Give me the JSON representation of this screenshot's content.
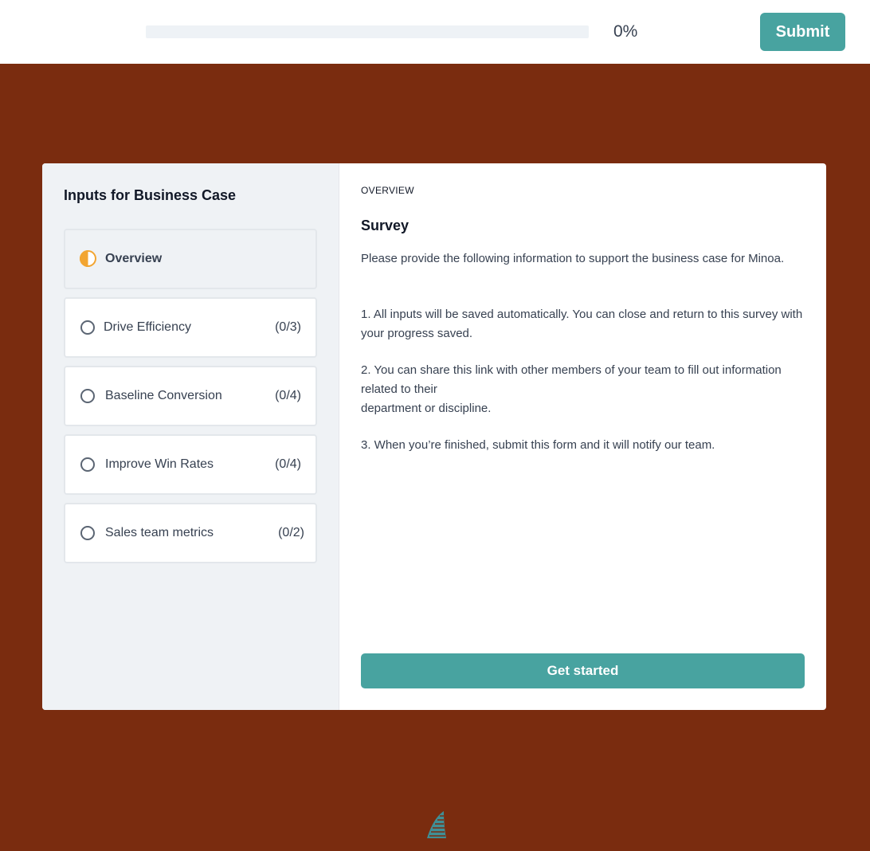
{
  "header": {
    "progress_percent": 0,
    "progress_text": "0%",
    "submit_label": "Submit"
  },
  "sidebar": {
    "title": "Inputs for Business Case",
    "items": [
      {
        "label": "Overview",
        "count": "",
        "status": "in-progress"
      },
      {
        "label": "Drive Efficiency",
        "count": "(0/3)",
        "status": "not-started"
      },
      {
        "label": "Baseline Conversion",
        "count": "(0/4)",
        "status": "not-started"
      },
      {
        "label": "Improve Win Rates",
        "count": "(0/4)",
        "status": "not-started"
      },
      {
        "label": "Sales team metrics",
        "count": "(0/2)",
        "status": "not-started"
      }
    ]
  },
  "main": {
    "section_label": "OVERVIEW",
    "title": "Survey",
    "intro": "Please provide the following information to support the business case for Minoa.",
    "point1": "1. All inputs will be saved automatically. You can close and return to this survey with your progress saved.",
    "point2_line1": "2. You can share this link with other members of your team to fill out information related to their",
    "point2_line2": "department or discipline.",
    "point3": "3. When you’re finished, submit this form and it will notify our team.",
    "cta_label": "Get started"
  },
  "colors": {
    "background": "#7a2c0f",
    "accent": "#48a3a0",
    "in_progress": "#f2a531"
  },
  "icons": {
    "footer": "minoa-logo-icon"
  }
}
